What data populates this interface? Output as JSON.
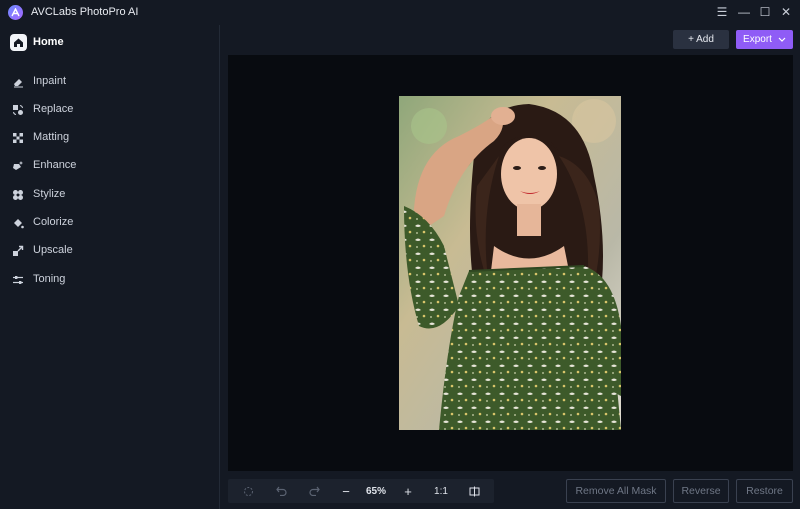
{
  "app": {
    "title": "AVCLabs PhotoPro AI",
    "logo_icon": "avclabs-logo-icon",
    "window_controls": [
      {
        "name": "menu-icon",
        "glyph": "☰"
      },
      {
        "name": "minimize-icon",
        "glyph": "—"
      },
      {
        "name": "maximize-icon",
        "glyph": "☐"
      },
      {
        "name": "close-icon",
        "glyph": "✕"
      }
    ]
  },
  "sidebar": {
    "home_label": "Home",
    "items": [
      {
        "label": "Inpaint",
        "icon": "eraser-icon"
      },
      {
        "label": "Replace",
        "icon": "replace-icon"
      },
      {
        "label": "Matting",
        "icon": "matting-icon"
      },
      {
        "label": "Enhance",
        "icon": "enhance-icon"
      },
      {
        "label": "Stylize",
        "icon": "stylize-icon"
      },
      {
        "label": "Colorize",
        "icon": "colorize-icon"
      },
      {
        "label": "Upscale",
        "icon": "upscale-icon"
      },
      {
        "label": "Toning",
        "icon": "toning-icon"
      }
    ]
  },
  "header": {
    "add_label": "+ Add",
    "export_label": "Export",
    "accent_color": "#8f5cf6"
  },
  "toolbar": {
    "zoom_out": "−",
    "zoom_level": "65%",
    "zoom_in": "+",
    "actual_size": "1:1"
  },
  "actions": {
    "remove_all_mask": "Remove All Mask",
    "reverse": "Reverse",
    "restore": "Restore"
  }
}
